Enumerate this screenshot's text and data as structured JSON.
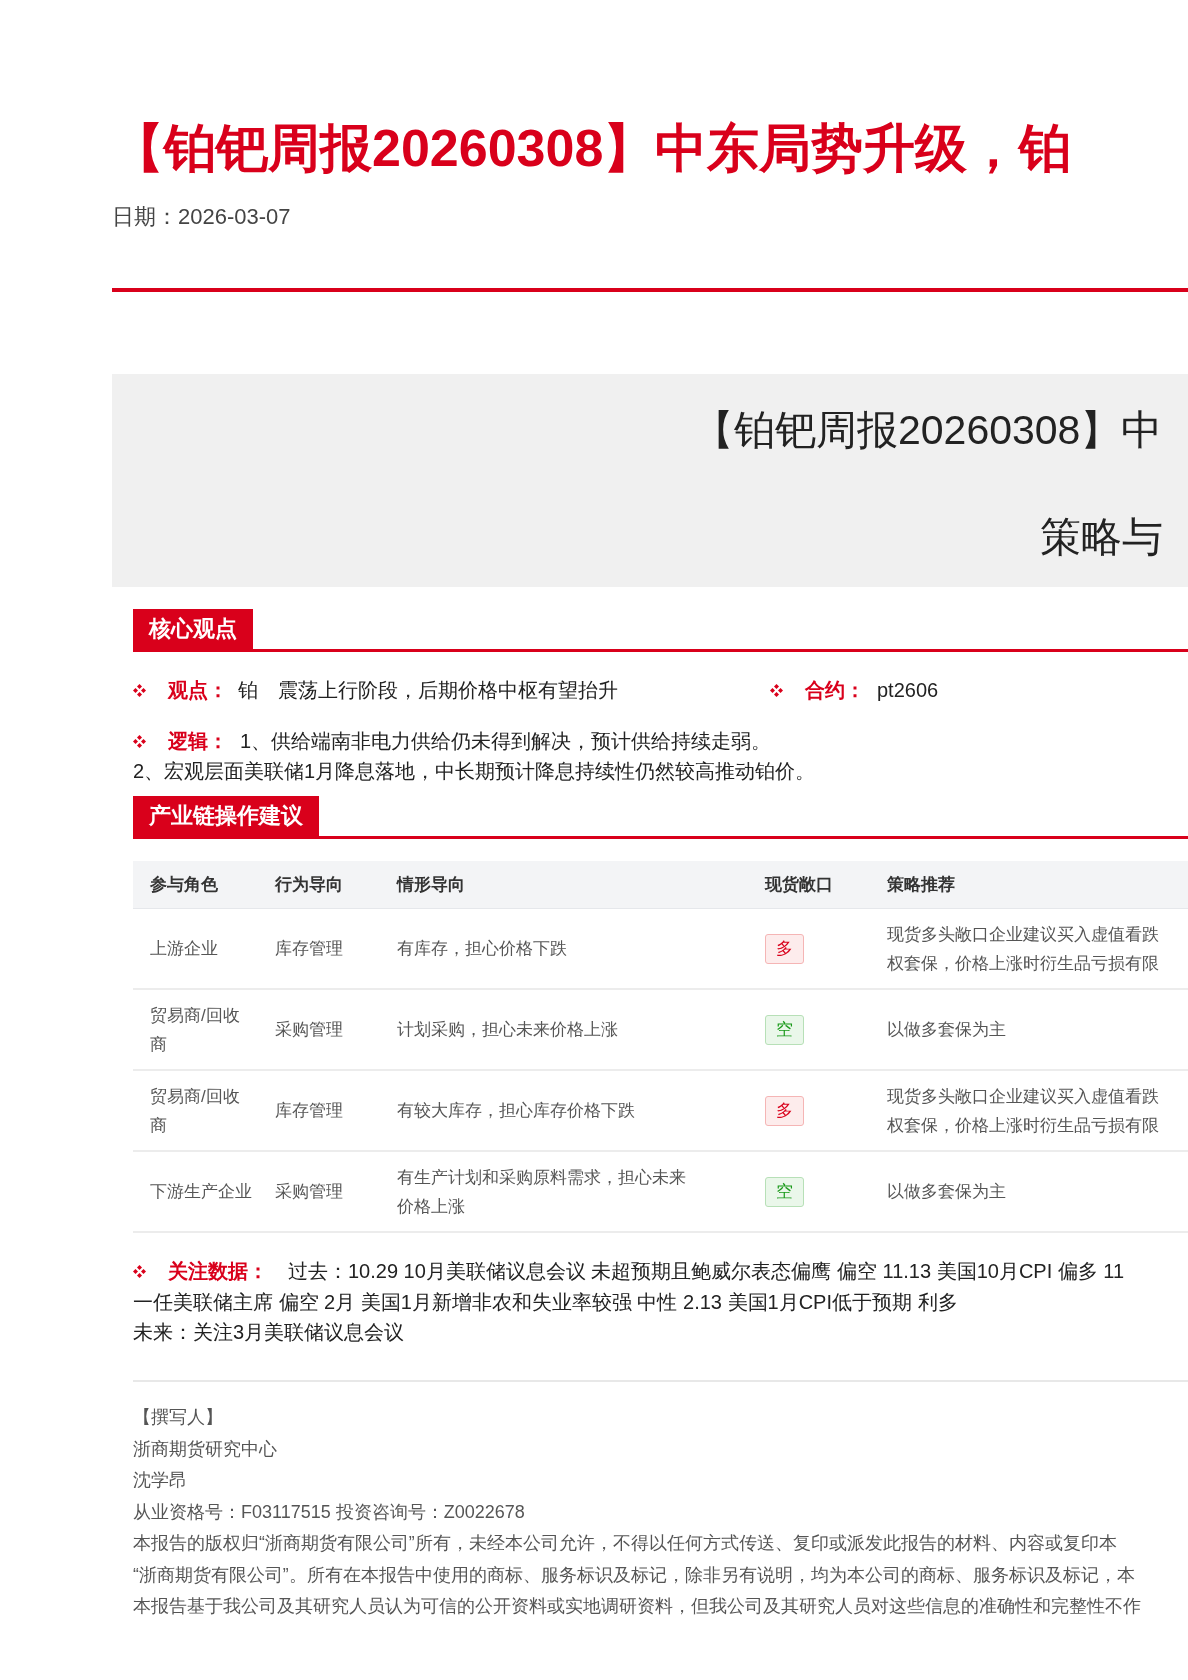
{
  "title": "【铂钯周报20260308】中东局势升级，铂",
  "date": "日期：2026-03-07",
  "banner": {
    "title": "【铂钯周报20260308】中",
    "subtitle": "策略与"
  },
  "core_section": {
    "heading": "核心观点",
    "view": {
      "label": "观点：",
      "metal": "铂",
      "text": "震荡上行阶段，后期价格中枢有望抬升"
    },
    "contract": {
      "label": "合约：",
      "value": "pt2606"
    },
    "logic": {
      "label": "逻辑：",
      "first_line": "1、供给端南非电力供给仍未得到解决，预计供给持续走弱。",
      "second_line": "2、宏观层面美联储1月降息落地，中长期预计降息持续性仍然较高推动铂价。"
    }
  },
  "chain_section": {
    "heading": "产业链操作建议",
    "table": {
      "columns": [
        "参与角色",
        "行为导向",
        "情形导向",
        "现货敞口",
        "策略推荐"
      ],
      "rows": [
        {
          "role": "上游企业",
          "behavior": "库存管理",
          "scenario": "有库存，担心价格下跌",
          "exposure": {
            "label": "多",
            "kind": "long"
          },
          "strategy": [
            "现货多头敞口企业建议买入虚值看跌",
            "权套保，价格上涨时衍生品亏损有限"
          ]
        },
        {
          "role": "贸易商/回收商",
          "behavior": "采购管理",
          "scenario": "计划采购，担心未来价格上涨",
          "exposure": {
            "label": "空",
            "kind": "short"
          },
          "strategy": [
            "以做多套保为主"
          ]
        },
        {
          "role": "贸易商/回收商",
          "behavior": "库存管理",
          "scenario": "有较大库存，担心库存价格下跌",
          "exposure": {
            "label": "多",
            "kind": "long"
          },
          "strategy": [
            "现货多头敞口企业建议买入虚值看跌",
            "权套保，价格上涨时衍生品亏损有限"
          ]
        },
        {
          "role": "下游生产企业",
          "behavior": "采购管理",
          "scenario": "有生产计划和采购原料需求，担心未来价格上涨",
          "exposure": {
            "label": "空",
            "kind": "short"
          },
          "strategy": [
            "以做多套保为主"
          ]
        }
      ]
    }
  },
  "watch": {
    "label": "关注数据：",
    "lines": [
      "过去：10.29 10月美联储议息会议 未超预期且鲍威尔表态偏鹰 偏空 11.13 美国10月CPI 偏多 11",
      "一任美联储主席 偏空 2月 美国1月新增非农和失业率较强 中性 2.13 美国1月CPI低于预期 利多"
    ],
    "future": "未来：关注3月美联储议息会议"
  },
  "author": {
    "heading": "【撰写人】",
    "org": "浙商期货研究中心",
    "name": "沈学昂",
    "license": "从业资格号：F03117515 投资咨询号：Z0022678"
  },
  "disclaimer": [
    "本报告的版权归“浙商期货有限公司”所有，未经本公司允许，不得以任何方式传送、复印或派发此报告的材料、内容或复印本",
    "“浙商期货有限公司”。所有在本报告中使用的商标、服务标识及标记，除非另有说明，均为本公司的商标、服务标识及标记，本",
    "本报告基于我公司及其研究人员认为可信的公开资料或实地调研资料，但我公司及其研究人员对这些信息的准确性和完整性不作"
  ]
}
